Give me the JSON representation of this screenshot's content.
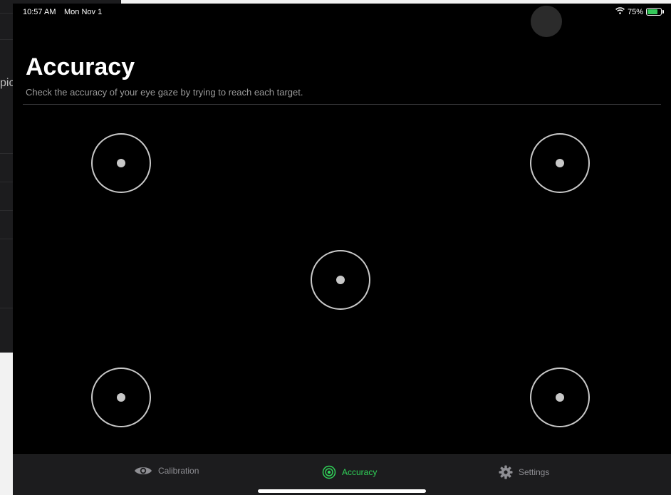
{
  "status_bar": {
    "time": "10:57 AM",
    "date": "Mon Nov 1",
    "battery_percent": "75%",
    "battery_level": 0.75,
    "icons": [
      "wifi-icon",
      "battery-charging-icon"
    ]
  },
  "background_app": {
    "partial_text": "pic"
  },
  "header": {
    "title": "Accuracy",
    "subtitle": "Check the accuracy of your eye gaze by trying to reach each target."
  },
  "targets": [
    "top-left",
    "top-right",
    "center",
    "bottom-left",
    "bottom-right"
  ],
  "tab_bar": {
    "tabs": [
      {
        "label": "Calibration",
        "icon": "eye-icon",
        "active": false
      },
      {
        "label": "Accuracy",
        "icon": "target-icon",
        "active": true
      },
      {
        "label": "Settings",
        "icon": "gear-icon",
        "active": false
      }
    ]
  },
  "colors": {
    "accent": "#30d158",
    "background": "#000000",
    "target": "#c8c8c8",
    "tab_inactive": "#8e8e93"
  }
}
